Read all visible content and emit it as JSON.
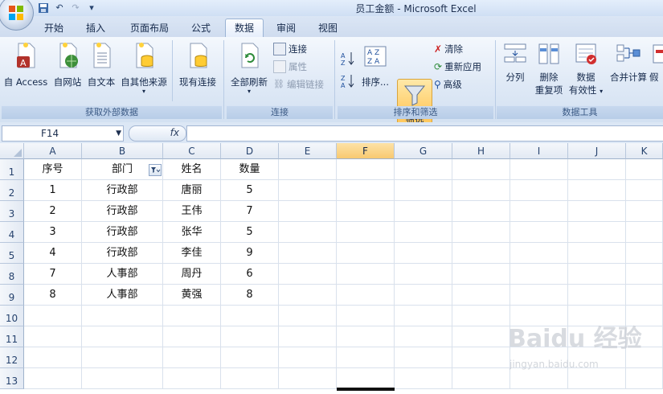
{
  "window": {
    "title": "员工金额 - Microsoft Excel"
  },
  "quick_access": {
    "icons": [
      "save-icon",
      "undo-icon",
      "redo-icon",
      "customize-icon"
    ]
  },
  "tabs": [
    {
      "label": "开始"
    },
    {
      "label": "插入"
    },
    {
      "label": "页面布局"
    },
    {
      "label": "公式"
    },
    {
      "label": "数据",
      "active": true
    },
    {
      "label": "审阅"
    },
    {
      "label": "视图"
    }
  ],
  "ribbon": {
    "groups": {
      "external": {
        "label": "获取外部数据",
        "buttons": {
          "access": "自 Access",
          "web": "自网站",
          "text": "自文本",
          "other": "自其他来源",
          "existing": "现有连接"
        }
      },
      "connections": {
        "label": "连接",
        "refresh_all": "全部刷新",
        "connections": "连接",
        "properties": "属性",
        "edit_links": "编辑链接"
      },
      "sort_filter": {
        "label": "排序和筛选",
        "sort": "排序...",
        "filter": "筛选",
        "clear": "清除",
        "reapply": "重新应用",
        "advanced": "高级"
      },
      "data_tools": {
        "label": "数据工具",
        "text_to_columns": "分列",
        "remove_duplicates_1": "删除",
        "remove_duplicates_2": "重复项",
        "validation_1": "数据",
        "validation_2": "有效性",
        "consolidate": "合并计算",
        "whatif": "假"
      }
    }
  },
  "formula_bar": {
    "name_box": "F14",
    "fx": "fx",
    "formula": ""
  },
  "sheet": {
    "columns": [
      "A",
      "B",
      "C",
      "D",
      "E",
      "F",
      "G",
      "H",
      "I",
      "J",
      "K"
    ],
    "selected_column": "F",
    "row_numbers": [
      "1",
      "2",
      "3",
      "4",
      "5",
      "8",
      "9",
      "10",
      "11",
      "12",
      "13"
    ],
    "header_row": [
      "序号",
      "部门",
      "姓名",
      "数量"
    ],
    "rows": [
      [
        "1",
        "行政部",
        "唐丽",
        "5"
      ],
      [
        "2",
        "行政部",
        "王伟",
        "7"
      ],
      [
        "3",
        "行政部",
        "张华",
        "5"
      ],
      [
        "4",
        "行政部",
        "李佳",
        "9"
      ],
      [
        "7",
        "人事部",
        "周丹",
        "6"
      ],
      [
        "8",
        "人事部",
        "黄强",
        "8"
      ]
    ]
  },
  "watermark": {
    "text": "Baidu 经验",
    "sub": "jingyan.baidu.com"
  }
}
